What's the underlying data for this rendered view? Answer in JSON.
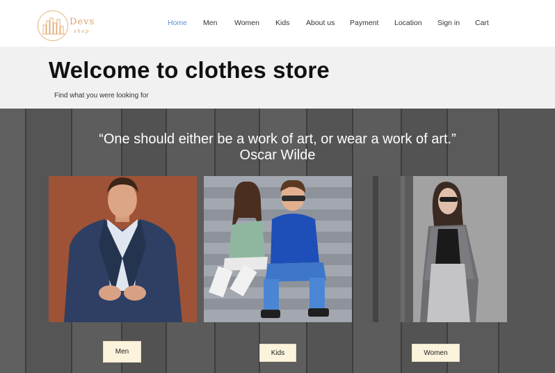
{
  "brand": {
    "name": "Devs",
    "tagline": "shop"
  },
  "nav": {
    "items": [
      {
        "label": "Home",
        "active": true
      },
      {
        "label": "Men",
        "active": false
      },
      {
        "label": "Women",
        "active": false
      },
      {
        "label": "Kids",
        "active": false
      },
      {
        "label": "About us",
        "active": false
      },
      {
        "label": "Payment",
        "active": false
      },
      {
        "label": "Location",
        "active": false
      },
      {
        "label": "Sign in",
        "active": false
      },
      {
        "label": "Cart",
        "active": false
      }
    ]
  },
  "hero": {
    "title": "Welcome to clothes store",
    "subtitle": "Find what you were looking for"
  },
  "quote": {
    "text": "“One should either be a work of art, or wear a work of art.”",
    "author": "Oscar Wilde"
  },
  "categories": [
    {
      "label": "Men"
    },
    {
      "label": "Kids"
    },
    {
      "label": "Women"
    }
  ],
  "colors": {
    "accent_active": "#5b8fd6",
    "logo": "#d9a46a",
    "hero_bg": "#f1f1f1",
    "wood_bg": "#585858",
    "button_bg": "#fbf3dc"
  }
}
